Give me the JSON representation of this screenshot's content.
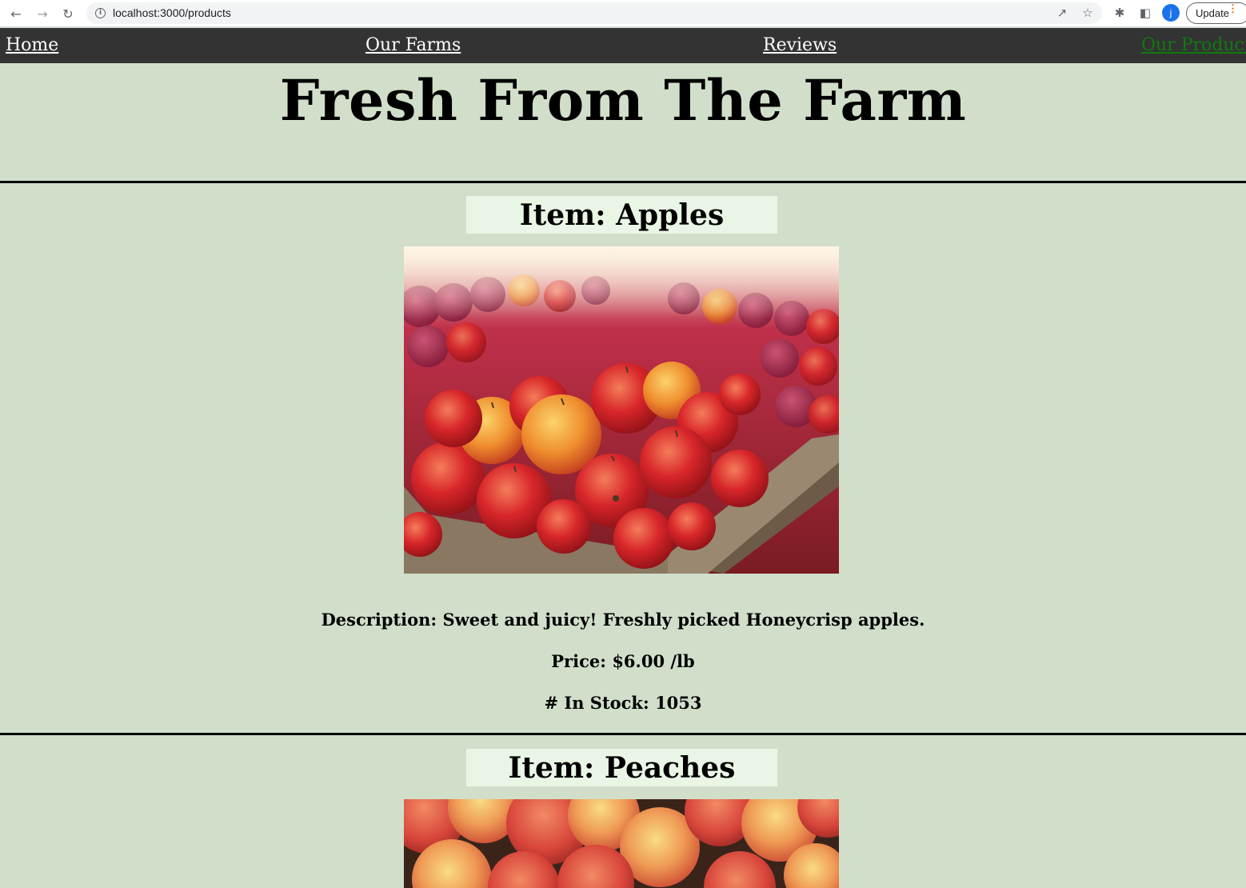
{
  "browser": {
    "url": "localhost:3000/products",
    "update_label": "Update",
    "profile_initial": "j"
  },
  "nav": {
    "items": [
      {
        "label": "Home"
      },
      {
        "label": "Our Farms"
      },
      {
        "label": "Reviews"
      },
      {
        "label": "Our Products",
        "active": true
      }
    ]
  },
  "page": {
    "title": "Fresh From The Farm"
  },
  "products": [
    {
      "item_label": "Item:",
      "name": "Apples",
      "description_label": "Description:",
      "description": "Sweet and juicy! Freshly picked Honeycrisp apples.",
      "price_label": "Price:",
      "price": "$6.00",
      "unit": "/lb",
      "stock_label": "# In Stock:",
      "stock": "1053"
    },
    {
      "item_label": "Item:",
      "name": "Peaches"
    }
  ],
  "colors": {
    "background": "#d1dfca",
    "nav_background": "#333333",
    "nav_active": "#0f7a0f",
    "item_title_bg": "#e9f6e5"
  }
}
